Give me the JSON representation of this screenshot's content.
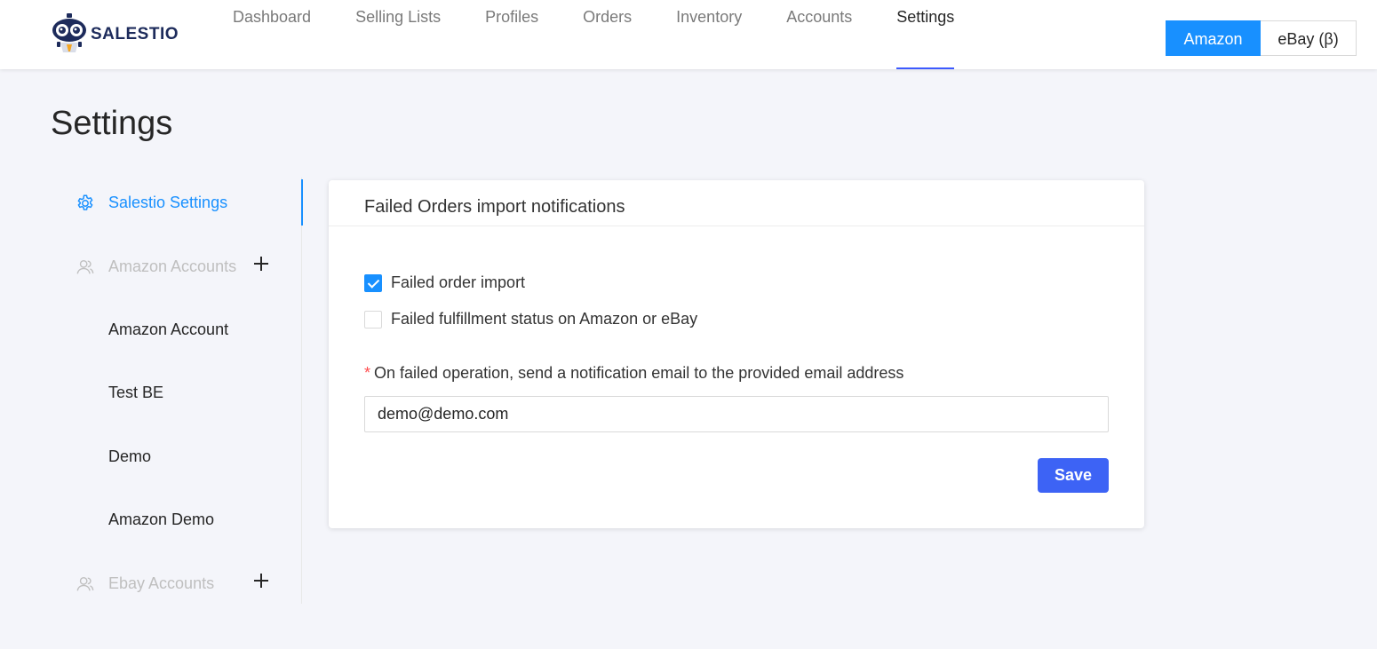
{
  "app": {
    "brand": "SALESTIO"
  },
  "nav": {
    "items": [
      {
        "label": "Dashboard"
      },
      {
        "label": "Selling Lists"
      },
      {
        "label": "Profiles"
      },
      {
        "label": "Orders"
      },
      {
        "label": "Inventory"
      },
      {
        "label": "Accounts"
      },
      {
        "label": "Settings"
      }
    ],
    "active": "Settings"
  },
  "marketplace": {
    "options": [
      "Amazon",
      "eBay (β)"
    ],
    "selected": "Amazon"
  },
  "page": {
    "title": "Settings"
  },
  "sidebar": {
    "items": [
      {
        "label": "Salestio Settings",
        "icon": "gear-icon",
        "type": "active"
      },
      {
        "label": "Amazon Accounts",
        "icon": "users-icon",
        "type": "group"
      },
      {
        "label": "Amazon Account",
        "type": "sub"
      },
      {
        "label": "Test BE",
        "type": "sub"
      },
      {
        "label": "Demo",
        "type": "sub"
      },
      {
        "label": "Amazon Demo",
        "type": "sub"
      },
      {
        "label": "Ebay Accounts",
        "icon": "users-icon",
        "type": "group"
      }
    ]
  },
  "card": {
    "title": "Failed Orders import notifications",
    "checkboxes": [
      {
        "label": "Failed order import",
        "checked": true
      },
      {
        "label": "Failed fulfillment status on Amazon or eBay",
        "checked": false
      }
    ],
    "email_label": "On failed operation, send a notification email to the provided email address",
    "required_mark": "*",
    "email_value": "demo@demo.com",
    "save_label": "Save"
  },
  "colors": {
    "accent": "#1890ff",
    "save": "#3d63f5",
    "required": "#ff4d4f",
    "background": "#f4f5fa"
  }
}
